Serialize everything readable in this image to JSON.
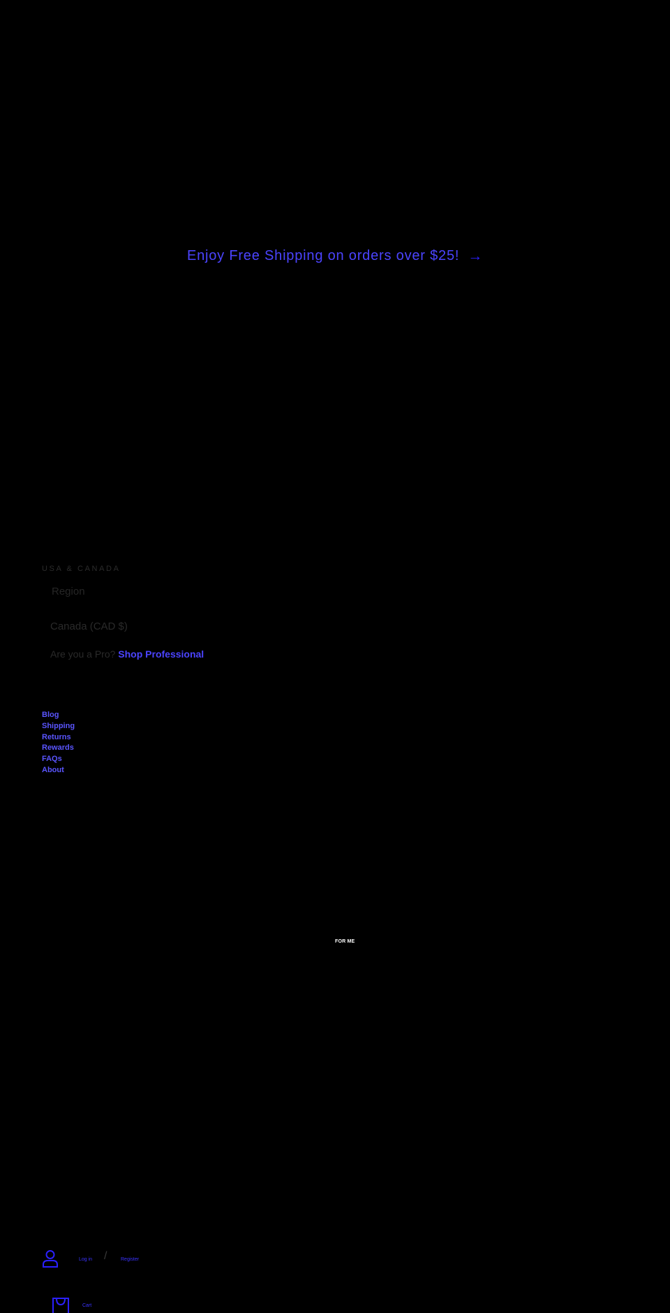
{
  "announcement": {
    "text": "Enjoy Free Shipping on orders over $25!",
    "arrow_icon": "arrow-right-icon"
  },
  "region": {
    "heading": "USA & CANADA",
    "label": "Region",
    "selected": "Canada (CAD $)",
    "pro_prompt": "Are you a Pro?",
    "pro_link": "Shop Professional"
  },
  "footer_links": [
    "Blog",
    "Shipping",
    "Returns",
    "Rewards",
    "FAQs",
    "About"
  ],
  "center_label": "FOR ME",
  "account": {
    "icon": "user-icon",
    "login": "Log in",
    "separator": "/",
    "register": "Register"
  },
  "cart": {
    "icon": "shopping-bag-icon",
    "label": "Cart"
  },
  "colors": {
    "background": "#000000",
    "link": "#4b44ff",
    "icon": "#2b20ff"
  }
}
